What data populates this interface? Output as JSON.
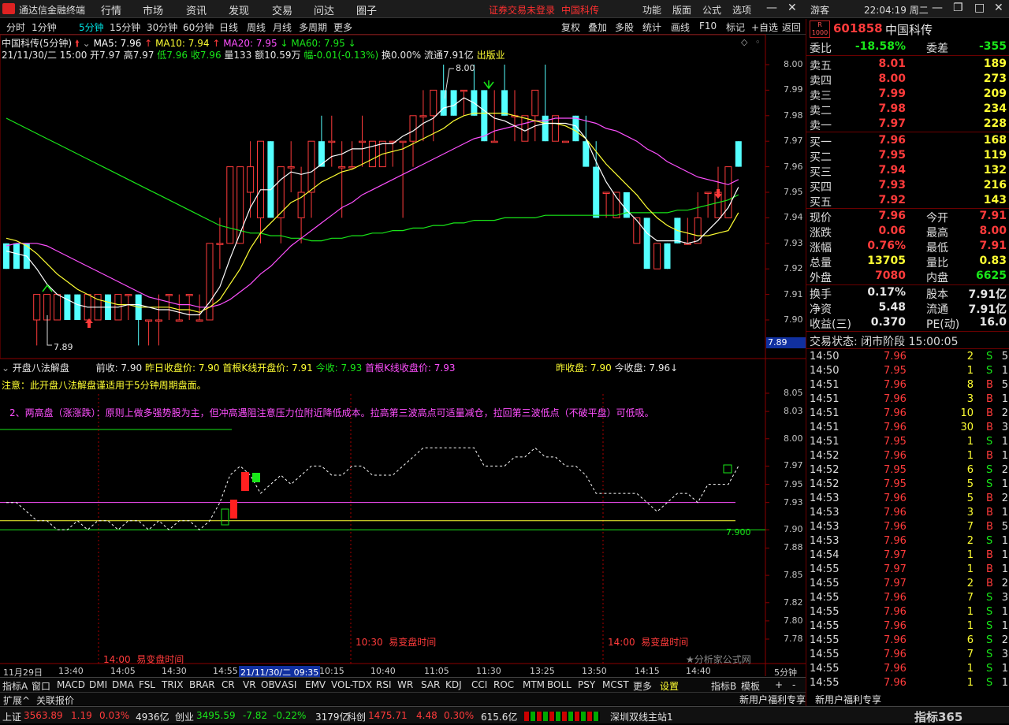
{
  "app": {
    "name": "通达信金融终端",
    "menus": [
      "行情",
      "市场",
      "资讯",
      "发现",
      "交易",
      "问达",
      "圈子"
    ],
    "warning": "证券交易未登录",
    "stock_title": "中国科传",
    "right_menus": [
      "功能",
      "版面",
      "公式",
      "选项"
    ],
    "user": "游客",
    "clock": "22:04:19 周二"
  },
  "toolbar": {
    "periods": [
      "分时",
      "1分钟",
      "5分钟",
      "15分钟",
      "30分钟",
      "60分钟",
      "日线",
      "周线",
      "月线",
      "多周期",
      "更多"
    ],
    "selected_period": "5分钟",
    "buttons": [
      "复权",
      "叠加",
      "多股",
      "统计",
      "画线",
      "F10",
      "标记",
      "+自选",
      "返回"
    ]
  },
  "main_chart": {
    "title": "中国科传(5分钟)",
    "ma": [
      {
        "label": "MA5: 7.96",
        "color": "#ffffff"
      },
      {
        "label": "MA10: 7.94",
        "color": "#ffff33"
      },
      {
        "label": "MA20: 7.95",
        "color": "#ff50ff"
      },
      {
        "label": "MA60: 7.95",
        "color": "#19e619"
      }
    ],
    "bar_info": {
      "datetime": "21/11/30/二 15:00",
      "open": "开7.97",
      "high": "高7.97",
      "low": "低7.96",
      "close": "收7.96",
      "volume": "量133",
      "amount": "额10.59万",
      "change": "幅-0.01(-0.13%)",
      "turnover": "换0.00%",
      "float": "流通7.91亿",
      "tag": "出版业"
    },
    "y_ticks": [
      "8.00",
      "7.99",
      "7.98",
      "7.97",
      "7.96",
      "7.95",
      "7.94",
      "7.93",
      "7.92",
      "7.91",
      "7.90"
    ],
    "cursor_price": "7.89",
    "high_marker": "8.00",
    "low_marker": "7.89"
  },
  "indicator": {
    "name": "开盘八法解盘",
    "items": [
      {
        "label": "前收: 7.90",
        "color": "#e6e6e6"
      },
      {
        "label": "昨日收盘价: 7.90",
        "color": "#ffff33"
      },
      {
        "label": "首根K线开盘价: 7.91",
        "color": "#ffff33"
      },
      {
        "label": "今收: 7.93",
        "color": "#19e619"
      },
      {
        "label": "首根K线收盘价: 7.93",
        "color": "#ff50ff"
      },
      {
        "label": "昨收盘: 7.90",
        "color": "#ffff33"
      },
      {
        "label": "今收盘: 7.96↓",
        "color": "#e6e6e6"
      }
    ],
    "note": "注意：此开盘八法解盘谨适用于5分钟周期盘面。",
    "tip": "2、两高盘（涨涨跌）：原则上做多强势股为主，但冲高遇阻注意压力位附近降低成本。拉高第三波高点可适量减仓，拉回第三波低点（不破平盘）可低吸。",
    "y_ticks": [
      "8.05",
      "8.03",
      "8.00",
      "7.97",
      "7.95",
      "7.93",
      "7.90",
      "7.88",
      "7.85",
      "7.82",
      "7.80",
      "7.78"
    ],
    "level_label": "7.900",
    "time_labels": [
      {
        "time": "14:00",
        "text": "易变盘时间"
      },
      {
        "time": "10:30",
        "text": "易变盘时间"
      },
      {
        "time": "14:00",
        "text": "易变盘时间"
      }
    ],
    "watermark": "★分析家公式网"
  },
  "x_axis": [
    "11月29日",
    "13:40",
    "14:05",
    "14:30",
    "14:55",
    "21/11/30/二 09:35",
    "10:15",
    "10:40",
    "11:05",
    "11:30",
    "13:25",
    "13:50",
    "14:15",
    "14:40"
  ],
  "x_axis_period": "5分钟",
  "indicator_tabs": [
    "指标A",
    "窗口",
    "MACD",
    "DMI",
    "DMA",
    "FSL",
    "TRIX",
    "BRAR",
    "CR",
    "VR",
    "OBV",
    "ASI",
    "EMV",
    "VOL-TDX",
    "RSI",
    "WR",
    "SAR",
    "KDJ",
    "CCI",
    "ROC",
    "MTM",
    "BOLL",
    "PSY",
    "MCST",
    "更多",
    "设置",
    "指标B",
    "模板",
    "+",
    "-"
  ],
  "sub_tabs": [
    "扩展^",
    "关联报价"
  ],
  "right_panel": {
    "code": "601858",
    "name": "中国科传",
    "weibi": {
      "label": "委比",
      "value": "-18.58%",
      "label2": "委差",
      "value2": "-355"
    },
    "asks": [
      {
        "label": "卖五",
        "price": "8.01",
        "vol": "189"
      },
      {
        "label": "卖四",
        "price": "8.00",
        "vol": "273"
      },
      {
        "label": "卖三",
        "price": "7.99",
        "vol": "209"
      },
      {
        "label": "卖二",
        "price": "7.98",
        "vol": "234"
      },
      {
        "label": "卖一",
        "price": "7.97",
        "vol": "228"
      }
    ],
    "bids": [
      {
        "label": "买一",
        "price": "7.96",
        "vol": "168"
      },
      {
        "label": "买二",
        "price": "7.95",
        "vol": "119"
      },
      {
        "label": "买三",
        "price": "7.94",
        "vol": "132"
      },
      {
        "label": "买四",
        "price": "7.93",
        "vol": "216"
      },
      {
        "label": "买五",
        "price": "7.92",
        "vol": "143"
      }
    ],
    "quote": [
      {
        "l1": "现价",
        "v1": "7.96",
        "c1": "red",
        "l2": "今开",
        "v2": "7.91",
        "c2": "red"
      },
      {
        "l1": "涨跌",
        "v1": "0.06",
        "c1": "red",
        "l2": "最高",
        "v2": "8.00",
        "c2": "red"
      },
      {
        "l1": "涨幅",
        "v1": "0.76%",
        "c1": "red",
        "l2": "最低",
        "v2": "7.91",
        "c2": "red"
      },
      {
        "l1": "总量",
        "v1": "13705",
        "c1": "yel",
        "l2": "量比",
        "v2": "0.83",
        "c2": "yel"
      },
      {
        "l1": "外盘",
        "v1": "7080",
        "c1": "red",
        "l2": "内盘",
        "v2": "6625",
        "c2": "grn"
      }
    ],
    "finance": [
      {
        "l1": "换手",
        "v1": "0.17%",
        "l2": "股本",
        "v2": "7.91亿"
      },
      {
        "l1": "净资",
        "v1": "5.48",
        "l2": "流通",
        "v2": "7.91亿"
      },
      {
        "l1": "收益(三)",
        "v1": "0.370",
        "l2": "PE(动)",
        "v2": "16.0"
      }
    ],
    "trade_status": "交易状态: 闭市阶段 15:00:05",
    "ticks": [
      {
        "t": "14:50",
        "p": "7.96",
        "q": "2",
        "s": "S",
        "n": "5",
        "c": "red"
      },
      {
        "t": "14:50",
        "p": "7.95",
        "q": "1",
        "s": "S",
        "n": "1",
        "c": "red"
      },
      {
        "t": "14:51",
        "p": "7.96",
        "q": "8",
        "s": "B",
        "n": "5",
        "c": "red"
      },
      {
        "t": "14:51",
        "p": "7.96",
        "q": "3",
        "s": "B",
        "n": "1",
        "c": "red"
      },
      {
        "t": "14:51",
        "p": "7.96",
        "q": "10",
        "s": "B",
        "n": "2",
        "c": "red"
      },
      {
        "t": "14:51",
        "p": "7.96",
        "q": "30",
        "s": "B",
        "n": "3",
        "c": "red"
      },
      {
        "t": "14:51",
        "p": "7.95",
        "q": "1",
        "s": "S",
        "n": "1",
        "c": "red"
      },
      {
        "t": "14:52",
        "p": "7.96",
        "q": "1",
        "s": "B",
        "n": "1",
        "c": "red"
      },
      {
        "t": "14:52",
        "p": "7.95",
        "q": "6",
        "s": "S",
        "n": "2",
        "c": "red"
      },
      {
        "t": "14:52",
        "p": "7.95",
        "q": "5",
        "s": "S",
        "n": "1",
        "c": "red"
      },
      {
        "t": "14:53",
        "p": "7.96",
        "q": "5",
        "s": "B",
        "n": "2",
        "c": "red"
      },
      {
        "t": "14:53",
        "p": "7.96",
        "q": "3",
        "s": "B",
        "n": "1",
        "c": "red"
      },
      {
        "t": "14:53",
        "p": "7.96",
        "q": "7",
        "s": "B",
        "n": "5",
        "c": "red"
      },
      {
        "t": "14:53",
        "p": "7.96",
        "q": "2",
        "s": "S",
        "n": "1",
        "c": "red"
      },
      {
        "t": "14:54",
        "p": "7.97",
        "q": "1",
        "s": "B",
        "n": "1",
        "c": "red"
      },
      {
        "t": "14:55",
        "p": "7.97",
        "q": "1",
        "s": "B",
        "n": "1",
        "c": "red"
      },
      {
        "t": "14:55",
        "p": "7.97",
        "q": "2",
        "s": "B",
        "n": "2",
        "c": "red"
      },
      {
        "t": "14:55",
        "p": "7.96",
        "q": "7",
        "s": "S",
        "n": "3",
        "c": "red"
      },
      {
        "t": "14:55",
        "p": "7.96",
        "q": "1",
        "s": "S",
        "n": "1",
        "c": "red"
      },
      {
        "t": "14:55",
        "p": "7.96",
        "q": "1",
        "s": "S",
        "n": "1",
        "c": "red"
      },
      {
        "t": "14:55",
        "p": "7.96",
        "q": "6",
        "s": "S",
        "n": "2",
        "c": "red"
      },
      {
        "t": "14:55",
        "p": "7.96",
        "q": "7",
        "s": "S",
        "n": "3",
        "c": "red"
      },
      {
        "t": "14:55",
        "p": "7.96",
        "q": "1",
        "s": "S",
        "n": "1",
        "c": "red"
      },
      {
        "t": "14:55",
        "p": "7.96",
        "q": "1",
        "s": "S",
        "n": "1",
        "c": "red"
      }
    ]
  },
  "status_bar": {
    "sh_label": "上证",
    "sh": "3563.89",
    "sh_chg": "1.19",
    "sh_pct": "0.03%",
    "sh_amt": "4936亿",
    "cy_label": "创业",
    "cy": "3495.59",
    "cy_chg": "-7.82",
    "cy_pct": "-0.22%",
    "cy_amt": "3179亿",
    "kc_label": "科创",
    "kc": "1475.71",
    "kc_chg": "4.48",
    "kc_pct": "0.30%",
    "kc_amt": "615.6亿",
    "server": "深圳双线主站1",
    "ad1": "新用户福利专享",
    "ad2": "新用户福利专享",
    "brand": "指标365"
  },
  "chart_data": {
    "type": "candlestick",
    "title": "中国科传(5分钟)",
    "x_labels": [
      "11月29日",
      "13:40",
      "14:05",
      "14:30",
      "14:55",
      "21/11/30/二 09:35",
      "10:15",
      "10:40",
      "11:05",
      "11:30",
      "13:25",
      "13:50",
      "14:15",
      "14:40"
    ],
    "ylim": [
      7.888,
      8.012
    ],
    "candles": [
      [
        7.93,
        7.93,
        7.92,
        7.92
      ],
      [
        7.93,
        7.93,
        7.92,
        7.92
      ],
      [
        7.93,
        7.93,
        7.92,
        7.92
      ],
      [
        7.9,
        7.91,
        7.89,
        7.91
      ],
      [
        7.9,
        7.91,
        7.9,
        7.91
      ],
      [
        7.9,
        7.91,
        7.9,
        7.91
      ],
      [
        7.91,
        7.91,
        7.9,
        7.9
      ],
      [
        7.91,
        7.91,
        7.9,
        7.9
      ],
      [
        7.9,
        7.91,
        7.9,
        7.91
      ],
      [
        7.9,
        7.91,
        7.9,
        7.91
      ],
      [
        7.91,
        7.91,
        7.9,
        7.9
      ],
      [
        7.9,
        7.91,
        7.9,
        7.91
      ],
      [
        7.91,
        7.91,
        7.9,
        7.91
      ],
      [
        7.91,
        7.91,
        7.89,
        7.9
      ],
      [
        7.9,
        7.9,
        7.89,
        7.9
      ],
      [
        7.9,
        7.91,
        7.89,
        7.9
      ],
      [
        7.91,
        7.91,
        7.9,
        7.91
      ],
      [
        7.9,
        7.91,
        7.9,
        7.9
      ],
      [
        7.91,
        7.91,
        7.9,
        7.91
      ],
      [
        7.9,
        7.91,
        7.9,
        7.9
      ],
      [
        7.9,
        7.93,
        7.9,
        7.93
      ],
      [
        7.93,
        7.94,
        7.92,
        7.93
      ],
      [
        7.93,
        7.96,
        7.93,
        7.96
      ],
      [
        7.93,
        7.96,
        7.93,
        7.96
      ],
      [
        7.95,
        7.97,
        7.94,
        7.96
      ],
      [
        7.94,
        7.97,
        7.93,
        7.97
      ],
      [
        7.97,
        7.97,
        7.94,
        7.94
      ],
      [
        7.94,
        7.96,
        7.93,
        7.96
      ],
      [
        7.96,
        7.97,
        7.95,
        7.96
      ],
      [
        7.94,
        7.96,
        7.93,
        7.95
      ],
      [
        7.95,
        7.97,
        7.94,
        7.97
      ],
      [
        7.97,
        7.98,
        7.96,
        7.96
      ],
      [
        7.97,
        7.98,
        7.96,
        7.97
      ],
      [
        7.96,
        7.97,
        7.94,
        7.96
      ],
      [
        7.96,
        7.97,
        7.96,
        7.96
      ],
      [
        7.97,
        7.98,
        7.96,
        7.97
      ],
      [
        7.96,
        7.97,
        7.96,
        7.97
      ],
      [
        7.96,
        7.97,
        7.96,
        7.97
      ],
      [
        7.97,
        7.97,
        7.96,
        7.97
      ],
      [
        7.97,
        7.97,
        7.94,
        7.97
      ],
      [
        7.97,
        7.98,
        7.96,
        7.98
      ],
      [
        7.98,
        7.99,
        7.97,
        7.98
      ],
      [
        7.98,
        7.99,
        7.97,
        7.99
      ],
      [
        7.99,
        8.0,
        7.98,
        7.98
      ],
      [
        7.99,
        7.99,
        7.98,
        7.98
      ],
      [
        7.99,
        7.99,
        7.98,
        7.99
      ],
      [
        7.99,
        8.0,
        7.98,
        7.98
      ],
      [
        7.99,
        7.99,
        7.97,
        7.97
      ],
      [
        7.97,
        7.99,
        7.97,
        7.97
      ],
      [
        7.99,
        8.0,
        7.98,
        7.98
      ],
      [
        7.98,
        7.99,
        7.97,
        7.98
      ],
      [
        7.97,
        7.98,
        7.97,
        7.98
      ],
      [
        7.98,
        7.99,
        7.97,
        7.99
      ],
      [
        7.98,
        8.0,
        7.97,
        7.97
      ],
      [
        7.97,
        7.98,
        7.97,
        7.98
      ],
      [
        7.97,
        7.97,
        7.97,
        7.97
      ],
      [
        7.98,
        7.98,
        7.97,
        7.97
      ],
      [
        7.97,
        7.98,
        7.96,
        7.96
      ],
      [
        7.96,
        7.97,
        7.94,
        7.94
      ],
      [
        7.95,
        7.95,
        7.94,
        7.95
      ],
      [
        7.94,
        7.95,
        7.94,
        7.95
      ],
      [
        7.95,
        7.95,
        7.94,
        7.94
      ],
      [
        7.93,
        7.94,
        7.93,
        7.94
      ],
      [
        7.94,
        7.94,
        7.92,
        7.92
      ],
      [
        7.92,
        7.93,
        7.92,
        7.93
      ],
      [
        7.93,
        7.93,
        7.92,
        7.92
      ],
      [
        7.94,
        7.94,
        7.93,
        7.93
      ],
      [
        7.93,
        7.94,
        7.93,
        7.93
      ],
      [
        7.93,
        7.95,
        7.93,
        7.94
      ],
      [
        7.95,
        7.95,
        7.94,
        7.95
      ],
      [
        7.94,
        7.96,
        7.94,
        7.95
      ],
      [
        7.94,
        7.96,
        7.94,
        7.96
      ],
      [
        7.97,
        7.97,
        7.96,
        7.96
      ]
    ],
    "ma5": [
      7.927,
      7.926,
      7.925,
      7.92,
      7.914,
      7.91,
      7.908,
      7.906,
      7.905,
      7.905,
      7.905,
      7.905,
      7.906,
      7.906,
      7.905,
      7.904,
      7.904,
      7.903,
      7.902,
      7.902,
      7.907,
      7.913,
      7.924,
      7.934,
      7.944,
      7.951,
      7.951,
      7.955,
      7.958,
      7.957,
      7.958,
      7.961,
      7.964,
      7.965,
      7.967,
      7.967,
      7.968,
      7.969,
      7.969,
      7.972,
      7.974,
      7.977,
      7.979,
      7.983,
      7.984,
      7.987,
      7.985,
      7.982,
      7.979,
      7.978,
      7.976,
      7.974,
      7.976,
      7.977,
      7.977,
      7.977,
      7.976,
      7.971,
      7.962,
      7.954,
      7.948,
      7.943,
      7.939,
      7.934,
      7.931,
      7.931,
      7.931,
      7.93,
      7.931,
      7.935,
      7.939,
      7.944,
      7.952
    ],
    "ma10": [
      7.932,
      7.931,
      7.929,
      7.926,
      7.922,
      7.918,
      7.915,
      7.912,
      7.91,
      7.908,
      7.907,
      7.906,
      7.906,
      7.905,
      7.905,
      7.905,
      7.905,
      7.904,
      7.904,
      7.903,
      7.905,
      7.908,
      7.914,
      7.92,
      7.928,
      7.934,
      7.938,
      7.942,
      7.946,
      7.948,
      7.951,
      7.954,
      7.956,
      7.958,
      7.959,
      7.961,
      7.963,
      7.965,
      7.966,
      7.967,
      7.969,
      7.971,
      7.973,
      7.975,
      7.978,
      7.98,
      7.981,
      7.981,
      7.981,
      7.981,
      7.98,
      7.979,
      7.978,
      7.977,
      7.977,
      7.976,
      7.974,
      7.971,
      7.966,
      7.961,
      7.957,
      7.953,
      7.949,
      7.944,
      7.94,
      7.937,
      7.935,
      7.934,
      7.933,
      7.933,
      7.934,
      7.935,
      7.942
    ],
    "ma20": [
      7.929,
      7.93,
      7.93,
      7.93,
      7.929,
      7.927,
      7.925,
      7.923,
      7.921,
      7.919,
      7.917,
      7.915,
      7.913,
      7.911,
      7.909,
      7.908,
      7.907,
      7.906,
      7.906,
      7.905,
      7.905,
      7.906,
      7.908,
      7.911,
      7.914,
      7.918,
      7.921,
      7.925,
      7.929,
      7.932,
      7.935,
      7.938,
      7.941,
      7.944,
      7.946,
      7.949,
      7.951,
      7.953,
      7.955,
      7.957,
      7.959,
      7.961,
      7.963,
      7.965,
      7.967,
      7.969,
      7.971,
      7.972,
      7.974,
      7.975,
      7.976,
      7.977,
      7.978,
      7.978,
      7.979,
      7.979,
      7.979,
      7.978,
      7.977,
      7.975,
      7.974,
      7.972,
      7.97,
      7.967,
      7.965,
      7.962,
      7.96,
      7.958,
      7.956,
      7.955,
      7.954,
      7.953,
      7.955
    ],
    "ma60": [
      7.979,
      7.977,
      7.975,
      7.973,
      7.971,
      7.969,
      7.967,
      7.965,
      7.963,
      7.961,
      7.959,
      7.957,
      7.955,
      7.953,
      7.951,
      7.949,
      7.947,
      7.945,
      7.943,
      7.941,
      7.939,
      7.937,
      7.936,
      7.935,
      7.934,
      7.934,
      7.933,
      7.933,
      7.932,
      7.932,
      7.931,
      7.931,
      7.932,
      7.932,
      7.933,
      7.933,
      7.934,
      7.934,
      7.935,
      7.935,
      7.936,
      7.936,
      7.937,
      7.937,
      7.938,
      7.938,
      7.939,
      7.939,
      7.939,
      7.94,
      7.94,
      7.94,
      7.94,
      7.941,
      7.941,
      7.941,
      7.941,
      7.941,
      7.941,
      7.941,
      7.941,
      7.942,
      7.942,
      7.942,
      7.942,
      7.942,
      7.943,
      7.943,
      7.944,
      7.945,
      7.946,
      7.947,
      7.949
    ],
    "indicator_ylim": [
      7.775,
      8.055
    ],
    "indicator_line": [
      7.93,
      7.93,
      7.92,
      7.91,
      7.91,
      7.9,
      7.9,
      7.91,
      7.9,
      7.91,
      7.91,
      7.9,
      7.91,
      7.91,
      7.9,
      7.91,
      7.9,
      7.91,
      7.91,
      7.9,
      7.91,
      7.93,
      7.96,
      7.97,
      7.96,
      7.94,
      7.95,
      7.96,
      7.95,
      7.96,
      7.97,
      7.97,
      7.96,
      7.96,
      7.97,
      7.97,
      7.96,
      7.96,
      7.96,
      7.97,
      7.98,
      7.99,
      7.99,
      7.99,
      7.99,
      7.99,
      7.99,
      7.97,
      7.97,
      7.97,
      7.98,
      7.98,
      7.99,
      7.98,
      7.98,
      7.97,
      7.97,
      7.96,
      7.94,
      7.94,
      7.94,
      7.94,
      7.94,
      7.93,
      7.92,
      7.93,
      7.94,
      7.94,
      7.93,
      7.95,
      7.95,
      7.95,
      7.97
    ],
    "levels": [
      {
        "value": 7.93,
        "color": "#ff50ff"
      },
      {
        "value": 7.91,
        "color": "#ffff33"
      },
      {
        "value": 7.9,
        "color": "#19e619"
      }
    ]
  }
}
